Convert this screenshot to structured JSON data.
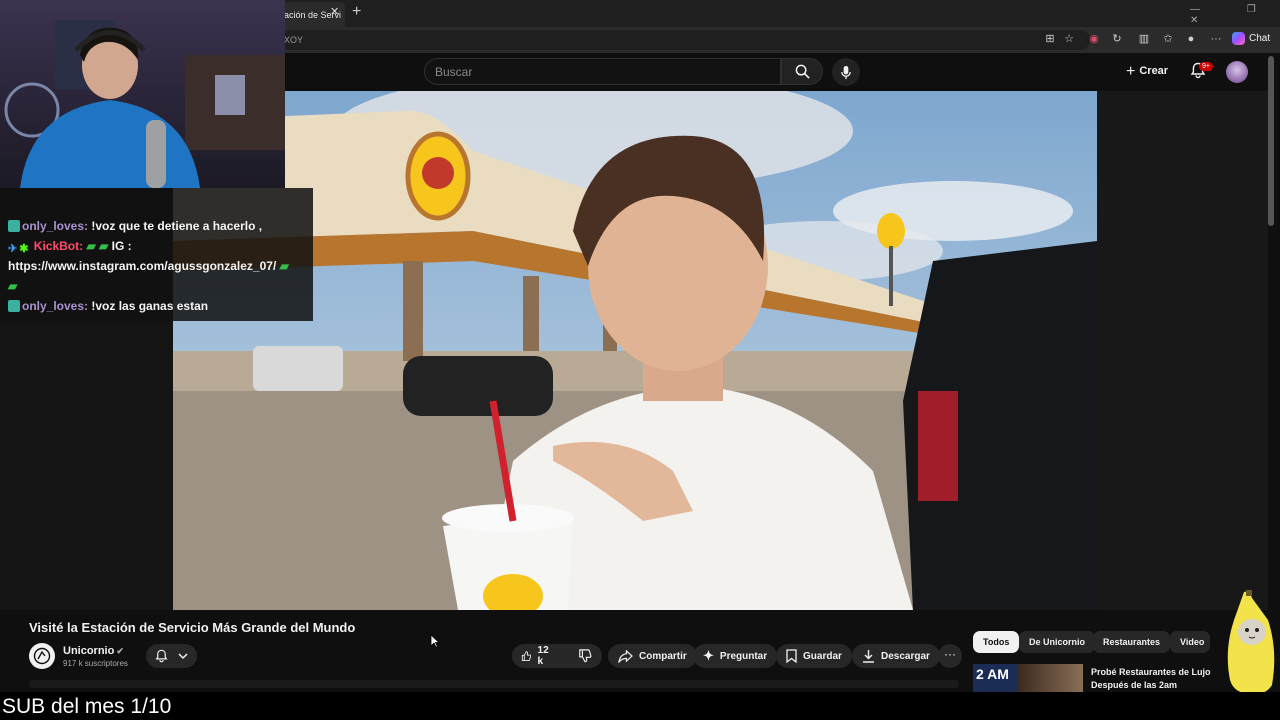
{
  "browser": {
    "tab_title": "ación de Servi",
    "tab_close": "✕",
    "new_tab": "+",
    "url_fragment": "XOY",
    "chat_label": "Chat",
    "window_controls": "— ❐ ✕"
  },
  "youtube_header": {
    "search_placeholder": "Buscar",
    "create_label": "Crear",
    "notification_count": "9+"
  },
  "chat_overlay": {
    "messages": [
      {
        "user": "only_loves:",
        "text": " !voz que te detiene a hacerlo ,"
      },
      {
        "user": "KickBot:",
        "text": " IG :"
      },
      {
        "user": "",
        "text": "https://www.instagram.com/agussgonzalez_07/"
      },
      {
        "user": "only_loves:",
        "text": " !voz las ganas estan"
      }
    ]
  },
  "video": {
    "title": "Visité la Estación de Servicio Más Grande del Mundo",
    "channel_name": "Unicornio",
    "verified_mark": "✔",
    "subscribers": "917 k suscriptores",
    "like_count": "12 k",
    "share_label": "Compartir",
    "ask_label": "Preguntar",
    "save_label": "Guardar",
    "download_label": "Descargar",
    "more_label": "···"
  },
  "chips": {
    "todos": "Todos",
    "channel": "De Unicornio",
    "restaurants": "Restaurantes",
    "videos": "Video"
  },
  "related": {
    "thumb_text": "2 AM",
    "title": "Probé Restaurantes de Lujo Después de las 2am"
  },
  "bottom_caption": "SUB del mes 1/10",
  "colors": {
    "bg": "#0f0f0f",
    "pill": "#272727",
    "notification_red": "#cc0000",
    "chat_user_a": "#a992d0",
    "chat_user_b": "#ff4a6b"
  }
}
